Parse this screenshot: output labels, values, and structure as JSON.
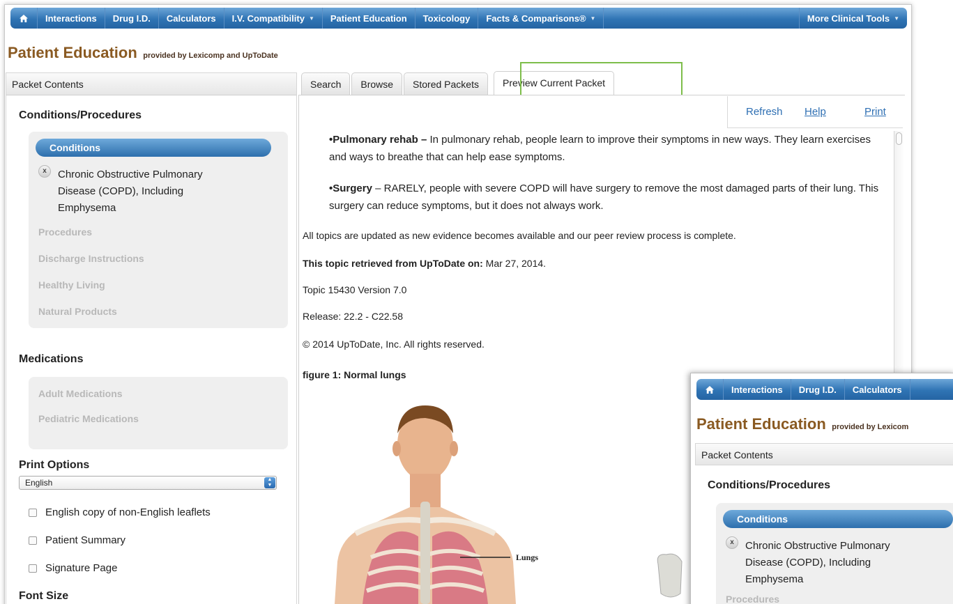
{
  "nav": {
    "home_icon": "home-icon",
    "items": [
      {
        "label": "Interactions"
      },
      {
        "label": "Drug I.D."
      },
      {
        "label": "Calculators"
      },
      {
        "label": "I.V. Compatibility"
      },
      {
        "label": "Patient Education"
      },
      {
        "label": "Toxicology"
      },
      {
        "label": "Facts & Comparisons®"
      }
    ],
    "more": "More Clinical Tools"
  },
  "page": {
    "title": "Patient Education",
    "subtitle": "provided by Lexicomp and UpToDate"
  },
  "sidebar": {
    "header": "Packet Contents",
    "conditions_heading": "Conditions/Procedures",
    "conditions_pill": "Conditions",
    "selected_item": "Chronic Obstructive Pulmonary Disease (COPD), Including Emphysema",
    "remove_glyph": "x",
    "categories": [
      "Procedures",
      "Discharge Instructions",
      "Healthy Living",
      "Natural Products"
    ],
    "medications_heading": "Medications",
    "medications": [
      "Adult Medications",
      "Pediatric Medications"
    ],
    "print_heading": "Print Options",
    "language": "English",
    "checkboxes": [
      "English copy of non-English leaflets",
      "Patient Summary",
      "Signature Page"
    ],
    "font_heading": "Font Size"
  },
  "tabs": [
    "Search",
    "Browse",
    "Stored Packets",
    "Preview Current Packet"
  ],
  "active_tab": "Preview Current Packet",
  "toolbar": {
    "refresh": "Refresh",
    "help": "Help",
    "print": "Print"
  },
  "content": {
    "p1_bold": "•Pulmonary rehab –",
    "p1_text": " In pulmonary rehab, people learn to improve their symptoms in new ways. They learn exercises and ways to breathe that can help ease symptoms.",
    "p2_bold": "•Surgery",
    "p2_text": " – RARELY, people with severe COPD will have surgery to remove the most damaged parts of their lung. This surgery can reduce symptoms, but it does not always work.",
    "updated": "All topics are updated as new evidence becomes available and our peer review process is complete.",
    "retrieved_label": "This topic retrieved from UpToDate on:",
    "retrieved_date": " Mar 27, 2014.",
    "topic": "Topic 15430 Version 7.0",
    "release": "Release: 22.2 - C22.58",
    "copyright": "© 2014 UpToDate, Inc. All rights reserved.",
    "figure_title": "figure 1: Normal lungs",
    "figure_label": "Lungs"
  },
  "overlay": {
    "nav": [
      "Interactions",
      "Drug I.D.",
      "Calculators"
    ],
    "title": "Patient Education",
    "subtitle": "provided by Lexicom",
    "header": "Packet Contents",
    "section": "Conditions/Procedures",
    "pill": "Conditions",
    "item": "Chronic Obstructive Pulmonary Disease (COPD), Including Emphysema",
    "next": "Procedures"
  },
  "colors": {
    "accent_blue": "#2f74b4",
    "title_brown": "#8a5a22",
    "highlight_green": "#7dbd4a",
    "link_blue": "#2e6fb3"
  }
}
